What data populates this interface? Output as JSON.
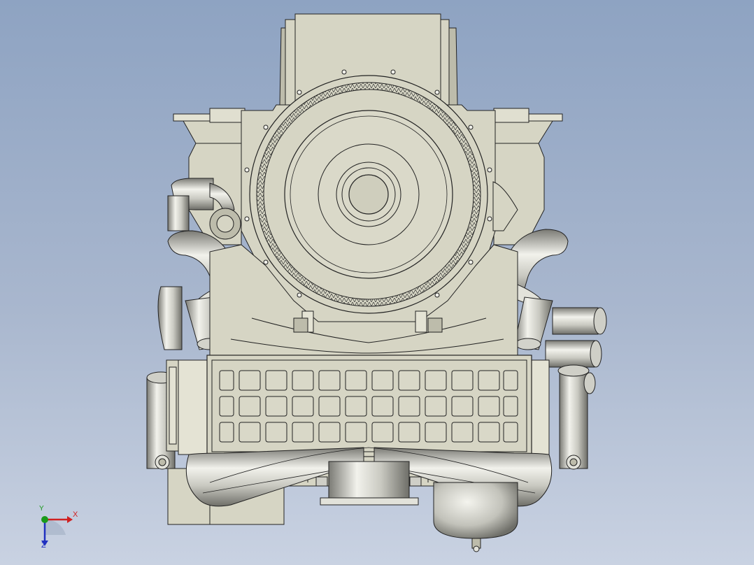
{
  "viewport": {
    "background_top": "#8ea3c2",
    "background_bottom": "#c9d2e2",
    "model": {
      "part_fill": "#d6d5c4",
      "part_fill_dark": "#bdbcab",
      "part_edge": "#222222",
      "metal_light": "#e9e9e3",
      "metal_mid": "#b4b4ac",
      "metal_dark": "#6e6e68"
    }
  },
  "triad": {
    "x_label": "X",
    "y_label": "Y",
    "z_label": "Z",
    "x_color": "#d02020",
    "y_color": "#1a9a1a",
    "z_color": "#2030c0"
  }
}
